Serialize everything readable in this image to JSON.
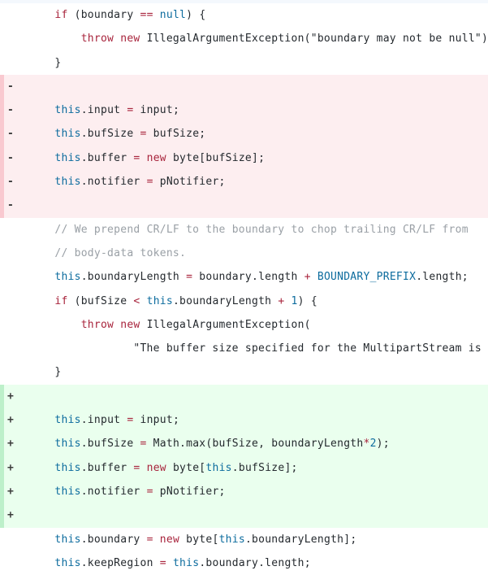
{
  "view": {
    "name": "unified-code-diff",
    "language": "java",
    "colors": {
      "deleted_background": "#fdeef0",
      "deleted_border": "#f9c9d0",
      "added_background": "#eaffee",
      "added_border": "#bdf0ca",
      "context_background": "#ffffff",
      "keyword": "#a8243c",
      "identifier_blue": "#0d6c9e",
      "comment": "#9aa0a6",
      "plain_text": "#24292e",
      "top_strip": "#f4f8fd"
    },
    "markers": {
      "deleted": "-",
      "added": "+",
      "context": ""
    }
  },
  "lines": [
    {
      "type": "context",
      "marker": "",
      "text": "    if (boundary == null) {",
      "tokens": [
        {
          "t": "    ",
          "c": "plain"
        },
        {
          "t": "if",
          "c": "kw"
        },
        {
          "t": " (boundary ",
          "c": "plain"
        },
        {
          "t": "==",
          "c": "op"
        },
        {
          "t": " ",
          "c": "plain"
        },
        {
          "t": "null",
          "c": "ident-blue"
        },
        {
          "t": ") {",
          "c": "plain"
        }
      ]
    },
    {
      "type": "context",
      "marker": "",
      "text": "        throw new IllegalArgumentException(\"boundary may not be null\");",
      "tokens": [
        {
          "t": "        ",
          "c": "plain"
        },
        {
          "t": "throw",
          "c": "kw"
        },
        {
          "t": " ",
          "c": "plain"
        },
        {
          "t": "new",
          "c": "kw"
        },
        {
          "t": " IllegalArgumentException(\"boundary may not be null\");",
          "c": "plain"
        }
      ]
    },
    {
      "type": "context",
      "marker": "",
      "text": "    }",
      "tokens": [
        {
          "t": "    }",
          "c": "plain"
        }
      ]
    },
    {
      "type": "deleted",
      "marker": "-",
      "text": "",
      "tokens": [
        {
          "t": "",
          "c": "plain"
        }
      ]
    },
    {
      "type": "deleted",
      "marker": "-",
      "text": "    this.input = input;",
      "tokens": [
        {
          "t": "    ",
          "c": "plain"
        },
        {
          "t": "this",
          "c": "ident-blue"
        },
        {
          "t": ".input ",
          "c": "plain"
        },
        {
          "t": "=",
          "c": "op"
        },
        {
          "t": " input;",
          "c": "plain"
        }
      ]
    },
    {
      "type": "deleted",
      "marker": "-",
      "text": "    this.bufSize = bufSize;",
      "tokens": [
        {
          "t": "    ",
          "c": "plain"
        },
        {
          "t": "this",
          "c": "ident-blue"
        },
        {
          "t": ".bufSize ",
          "c": "plain"
        },
        {
          "t": "=",
          "c": "op"
        },
        {
          "t": " bufSize;",
          "c": "plain"
        }
      ]
    },
    {
      "type": "deleted",
      "marker": "-",
      "text": "    this.buffer = new byte[bufSize];",
      "tokens": [
        {
          "t": "    ",
          "c": "plain"
        },
        {
          "t": "this",
          "c": "ident-blue"
        },
        {
          "t": ".buffer ",
          "c": "plain"
        },
        {
          "t": "=",
          "c": "op"
        },
        {
          "t": " ",
          "c": "plain"
        },
        {
          "t": "new",
          "c": "kw"
        },
        {
          "t": " byte[bufSize];",
          "c": "plain"
        }
      ]
    },
    {
      "type": "deleted",
      "marker": "-",
      "text": "    this.notifier = pNotifier;",
      "tokens": [
        {
          "t": "    ",
          "c": "plain"
        },
        {
          "t": "this",
          "c": "ident-blue"
        },
        {
          "t": ".notifier ",
          "c": "plain"
        },
        {
          "t": "=",
          "c": "op"
        },
        {
          "t": " pNotifier;",
          "c": "plain"
        }
      ]
    },
    {
      "type": "deleted",
      "marker": "-",
      "text": "",
      "tokens": [
        {
          "t": "",
          "c": "plain"
        }
      ]
    },
    {
      "type": "context",
      "marker": "",
      "text": "    // We prepend CR/LF to the boundary to chop trailing CR/LF from",
      "tokens": [
        {
          "t": "    ",
          "c": "plain"
        },
        {
          "t": "// We prepend CR/LF to the boundary to chop trailing CR/LF from",
          "c": "cmt"
        }
      ]
    },
    {
      "type": "context",
      "marker": "",
      "text": "    // body-data tokens.",
      "tokens": [
        {
          "t": "    ",
          "c": "plain"
        },
        {
          "t": "// body-data tokens.",
          "c": "cmt"
        }
      ]
    },
    {
      "type": "context",
      "marker": "",
      "text": "    this.boundaryLength = boundary.length + BOUNDARY_PREFIX.length;",
      "tokens": [
        {
          "t": "    ",
          "c": "plain"
        },
        {
          "t": "this",
          "c": "ident-blue"
        },
        {
          "t": ".boundaryLength ",
          "c": "plain"
        },
        {
          "t": "=",
          "c": "op"
        },
        {
          "t": " boundary.length ",
          "c": "plain"
        },
        {
          "t": "+",
          "c": "op"
        },
        {
          "t": " ",
          "c": "plain"
        },
        {
          "t": "BOUNDARY_PREFIX",
          "c": "ident-blue"
        },
        {
          "t": ".length;",
          "c": "plain"
        }
      ]
    },
    {
      "type": "context",
      "marker": "",
      "text": "    if (bufSize < this.boundaryLength + 1) {",
      "tokens": [
        {
          "t": "    ",
          "c": "plain"
        },
        {
          "t": "if",
          "c": "kw"
        },
        {
          "t": " (bufSize ",
          "c": "plain"
        },
        {
          "t": "<",
          "c": "op"
        },
        {
          "t": " ",
          "c": "plain"
        },
        {
          "t": "this",
          "c": "ident-blue"
        },
        {
          "t": ".boundaryLength ",
          "c": "plain"
        },
        {
          "t": "+",
          "c": "op"
        },
        {
          "t": " ",
          "c": "plain"
        },
        {
          "t": "1",
          "c": "num"
        },
        {
          "t": ") {",
          "c": "plain"
        }
      ]
    },
    {
      "type": "context",
      "marker": "",
      "text": "        throw new IllegalArgumentException(",
      "tokens": [
        {
          "t": "        ",
          "c": "plain"
        },
        {
          "t": "throw",
          "c": "kw"
        },
        {
          "t": " ",
          "c": "plain"
        },
        {
          "t": "new",
          "c": "kw"
        },
        {
          "t": " IllegalArgumentException(",
          "c": "plain"
        }
      ]
    },
    {
      "type": "context",
      "marker": "",
      "text": "                \"The buffer size specified for the MultipartStream is too small\");",
      "tokens": [
        {
          "t": "                \"The buffer size specified for the MultipartStream is too small\");",
          "c": "plain"
        }
      ]
    },
    {
      "type": "context",
      "marker": "",
      "text": "    }",
      "tokens": [
        {
          "t": "    }",
          "c": "plain"
        }
      ]
    },
    {
      "type": "added",
      "marker": "+",
      "text": "",
      "tokens": [
        {
          "t": "",
          "c": "plain"
        }
      ]
    },
    {
      "type": "added",
      "marker": "+",
      "text": "    this.input = input;",
      "tokens": [
        {
          "t": "    ",
          "c": "plain"
        },
        {
          "t": "this",
          "c": "ident-blue"
        },
        {
          "t": ".input ",
          "c": "plain"
        },
        {
          "t": "=",
          "c": "op"
        },
        {
          "t": " input;",
          "c": "plain"
        }
      ]
    },
    {
      "type": "added",
      "marker": "+",
      "text": "    this.bufSize = Math.max(bufSize, boundaryLength*2);",
      "tokens": [
        {
          "t": "    ",
          "c": "plain"
        },
        {
          "t": "this",
          "c": "ident-blue"
        },
        {
          "t": ".bufSize ",
          "c": "plain"
        },
        {
          "t": "=",
          "c": "op"
        },
        {
          "t": " Math.max(bufSize, boundaryLength",
          "c": "plain"
        },
        {
          "t": "*",
          "c": "op"
        },
        {
          "t": "2",
          "c": "num"
        },
        {
          "t": ");",
          "c": "plain"
        }
      ]
    },
    {
      "type": "added",
      "marker": "+",
      "text": "    this.buffer = new byte[this.bufSize];",
      "tokens": [
        {
          "t": "    ",
          "c": "plain"
        },
        {
          "t": "this",
          "c": "ident-blue"
        },
        {
          "t": ".buffer ",
          "c": "plain"
        },
        {
          "t": "=",
          "c": "op"
        },
        {
          "t": " ",
          "c": "plain"
        },
        {
          "t": "new",
          "c": "kw"
        },
        {
          "t": " byte[",
          "c": "plain"
        },
        {
          "t": "this",
          "c": "ident-blue"
        },
        {
          "t": ".bufSize];",
          "c": "plain"
        }
      ]
    },
    {
      "type": "added",
      "marker": "+",
      "text": "    this.notifier = pNotifier;",
      "tokens": [
        {
          "t": "    ",
          "c": "plain"
        },
        {
          "t": "this",
          "c": "ident-blue"
        },
        {
          "t": ".notifier ",
          "c": "plain"
        },
        {
          "t": "=",
          "c": "op"
        },
        {
          "t": " pNotifier;",
          "c": "plain"
        }
      ]
    },
    {
      "type": "added",
      "marker": "+",
      "text": "",
      "tokens": [
        {
          "t": "",
          "c": "plain"
        }
      ]
    },
    {
      "type": "context",
      "marker": "",
      "text": "    this.boundary = new byte[this.boundaryLength];",
      "tokens": [
        {
          "t": "    ",
          "c": "plain"
        },
        {
          "t": "this",
          "c": "ident-blue"
        },
        {
          "t": ".boundary ",
          "c": "plain"
        },
        {
          "t": "=",
          "c": "op"
        },
        {
          "t": " ",
          "c": "plain"
        },
        {
          "t": "new",
          "c": "kw"
        },
        {
          "t": " byte[",
          "c": "plain"
        },
        {
          "t": "this",
          "c": "ident-blue"
        },
        {
          "t": ".boundaryLength];",
          "c": "plain"
        }
      ]
    },
    {
      "type": "context",
      "marker": "",
      "text": "    this.keepRegion = this.boundary.length;",
      "tokens": [
        {
          "t": "    ",
          "c": "plain"
        },
        {
          "t": "this",
          "c": "ident-blue"
        },
        {
          "t": ".keepRegion ",
          "c": "plain"
        },
        {
          "t": "=",
          "c": "op"
        },
        {
          "t": " ",
          "c": "plain"
        },
        {
          "t": "this",
          "c": "ident-blue"
        },
        {
          "t": ".boundary.length;",
          "c": "plain"
        }
      ]
    }
  ]
}
